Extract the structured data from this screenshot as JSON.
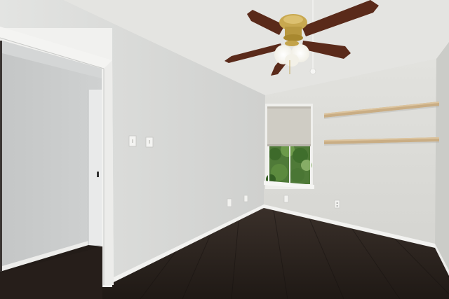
{
  "scene": {
    "kind": "empty-bedroom-photo",
    "colors": {
      "ceiling": "#e6e6e4",
      "wall_left": "#d9dad8",
      "wall_back": "#dcdcd8",
      "wall_right": "#cfd0cc",
      "floor": "#2a221e",
      "trim": "#f2f2f0",
      "shelf": "#c9ad84",
      "blade": "#5a2a1a",
      "brass": "#c8a850",
      "shade": "#cfccc4",
      "window_green": "#4f7a38"
    },
    "icons": [
      "ceiling-fan-icon",
      "light-switch-icon",
      "electrical-outlet-icon",
      "window-icon",
      "shelf-icon",
      "door-icon"
    ]
  }
}
